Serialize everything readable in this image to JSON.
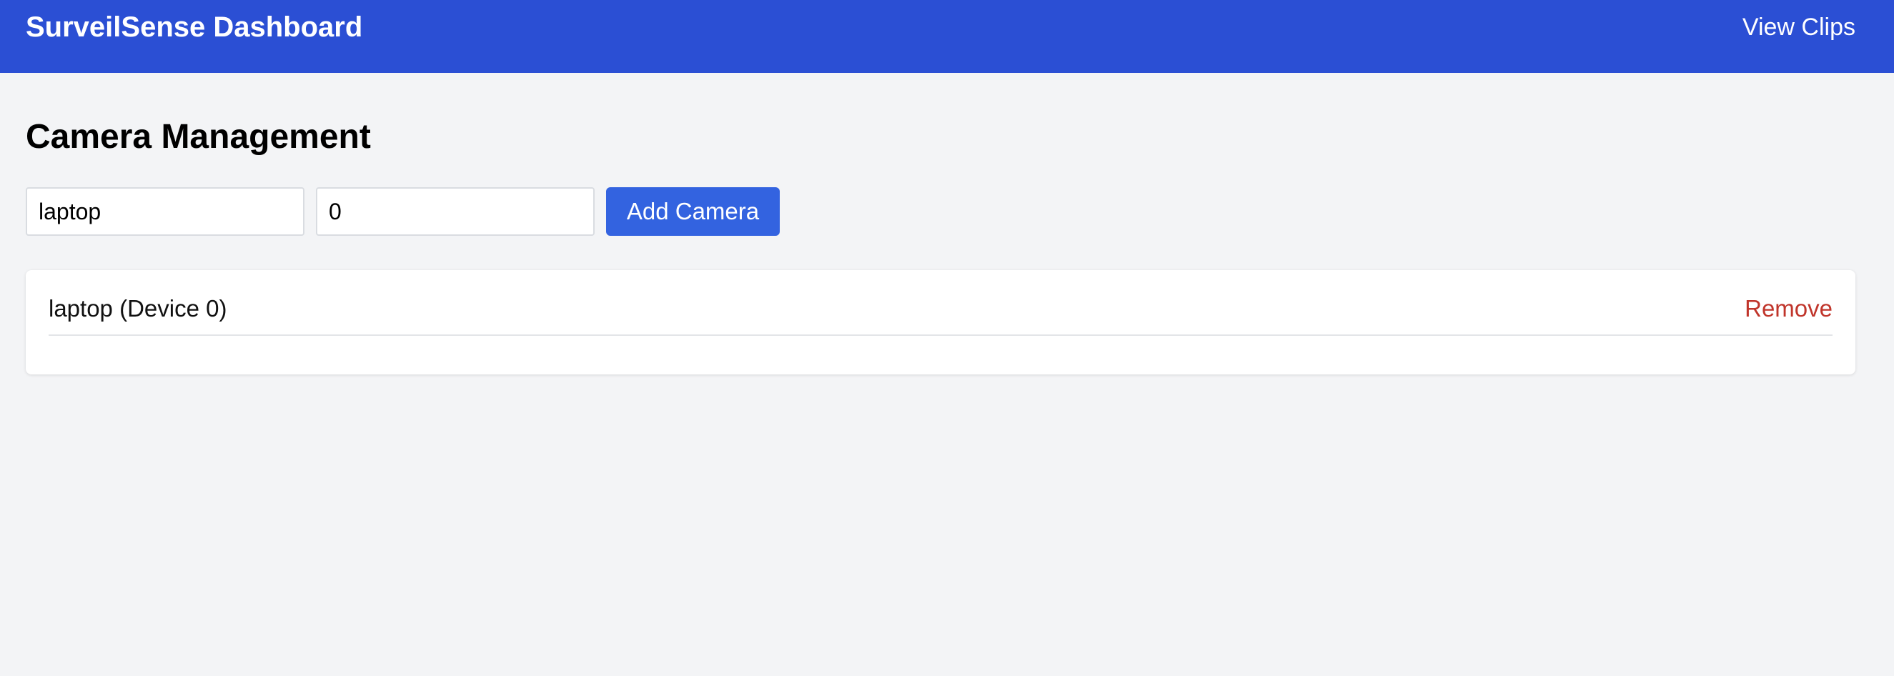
{
  "header": {
    "title": "SurveilSense Dashboard",
    "nav_link": "View Clips"
  },
  "main": {
    "title": "Camera Management",
    "form": {
      "name_value": "laptop",
      "device_value": "0",
      "add_button_label": "Add Camera"
    },
    "cameras": [
      {
        "label": "laptop (Device 0)",
        "remove_label": "Remove"
      }
    ]
  },
  "colors": {
    "header_bg": "#2b4fd4",
    "primary_button": "#3363e0",
    "danger_text": "#c0352b",
    "page_bg": "#f3f4f6"
  }
}
